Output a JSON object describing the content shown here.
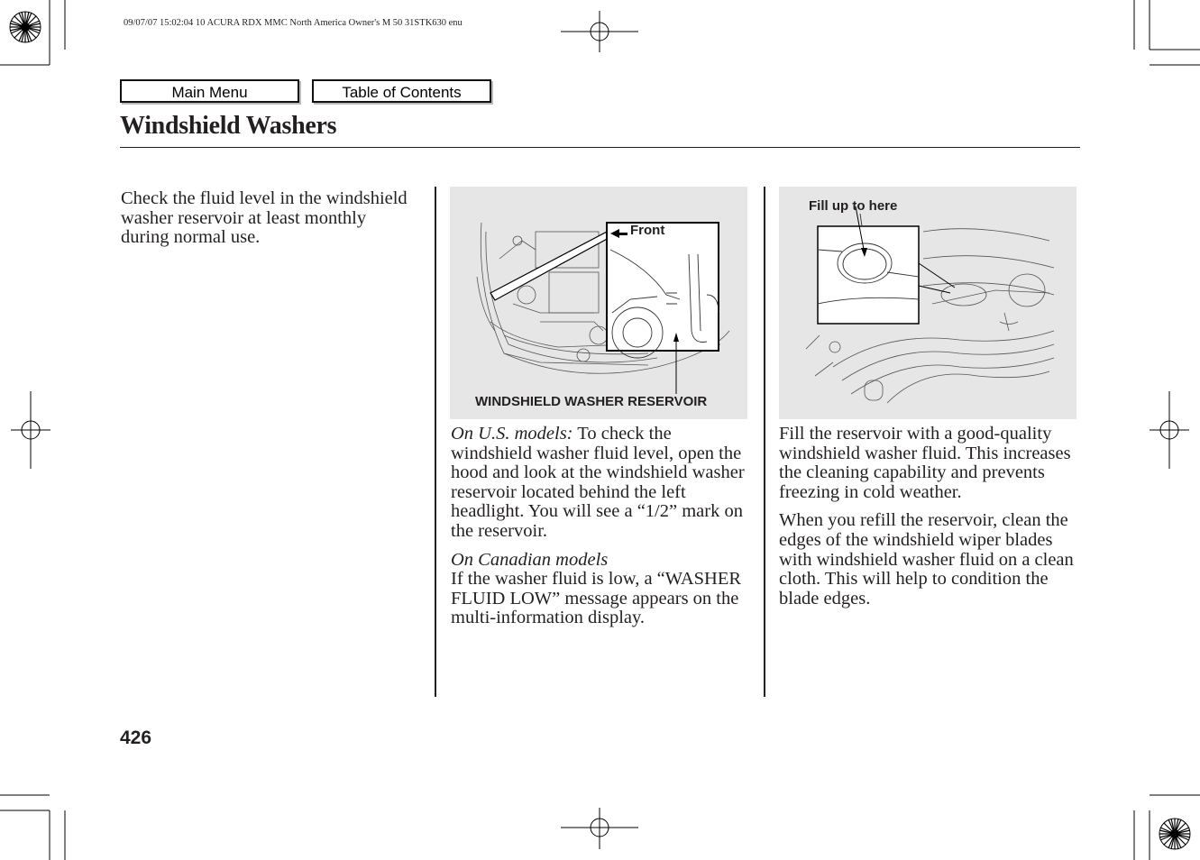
{
  "print_meta": "09/07/07 15:02:04    10 ACURA RDX MMC North America Owner's M 50 31STK630 enu",
  "nav": {
    "main_menu_label": "Main Menu",
    "toc_label": "Table of Contents"
  },
  "page": {
    "title": "Windshield Washers",
    "page_number": "426"
  },
  "column1": {
    "text": "Check the fluid level in the windshield washer reservoir at least monthly during normal use."
  },
  "figure1": {
    "label_front": "Front",
    "label_reservoir": "WINDSHIELD WASHER RESERVOIR"
  },
  "column2": {
    "us_label": "On U.S. models:",
    "us_text": " To check the windshield washer fluid level, open the hood and look at the windshield washer reservoir located behind the left headlight. You will see a “1/2” mark on the reservoir.",
    "canada_label": "On Canadian models",
    "canada_text": "If the washer fluid is low, a “WASHER FLUID LOW” message appears on the multi-information display."
  },
  "figure2": {
    "label_fill": "Fill up to here"
  },
  "column3": {
    "para1": "Fill the reservoir with a good-quality windshield washer fluid. This increases the cleaning capability and prevents freezing in cold weather.",
    "para2": "When you refill the reservoir, clean the edges of the windshield wiper blades with windshield washer fluid on a clean cloth. This will help to condition the blade edges."
  }
}
